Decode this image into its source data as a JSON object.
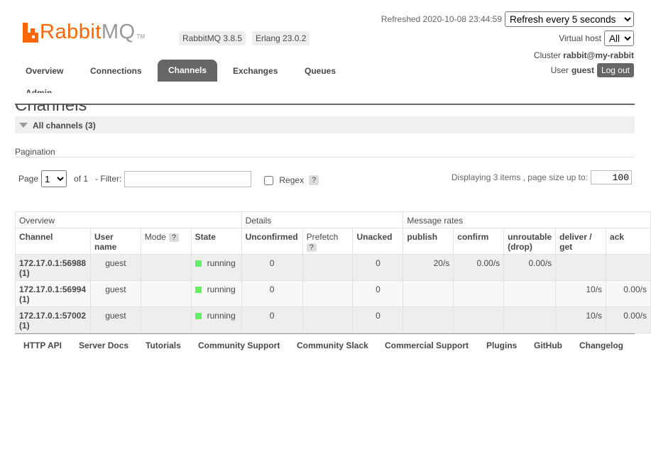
{
  "header": {
    "logo_text_a": "Rabbit",
    "logo_text_b": "MQ",
    "logo_tm": "TM",
    "version": "RabbitMQ 3.8.5",
    "erlang": "Erlang 23.0.2",
    "refreshed_label": "Refreshed 2020-10-08 23:44:59",
    "refresh_option": "Refresh every 5 seconds",
    "vhost_label": "Virtual host",
    "vhost_value": "All",
    "cluster_label": "Cluster",
    "cluster_value": "rabbit@my-rabbit",
    "user_label": "User",
    "user_value": "guest",
    "logout": "Log out"
  },
  "nav": {
    "items": [
      "Overview",
      "Connections",
      "Channels",
      "Exchanges",
      "Queues",
      "Admin"
    ],
    "active": "Channels"
  },
  "page": {
    "title": "Channels",
    "section": "All channels (3)",
    "pagination_label": "Pagination",
    "page_label": "Page",
    "page_value": "1",
    "of_label": "of 1",
    "filter_label": "- Filter:",
    "filter_value": "",
    "regex_label": "Regex",
    "help": "?",
    "displaying": "Displaying 3 items , page size up to:",
    "page_size": "100"
  },
  "table": {
    "groups": [
      "Overview",
      "Details",
      "Message rates"
    ],
    "columns": [
      "Channel",
      "User name",
      "Mode",
      "State",
      "Unconfirmed",
      "Prefetch",
      "Unacked",
      "publish",
      "confirm",
      "unroutable (drop)",
      "deliver / get",
      "ack"
    ],
    "rows": [
      {
        "channel": "172.17.0.1:56988 (1)",
        "user": "guest",
        "mode": "",
        "state": "running",
        "unconfirmed": "0",
        "prefetch": "",
        "unacked": "0",
        "publish": "20/s",
        "confirm": "0.00/s",
        "unroutable": "0.00/s",
        "deliver": "",
        "ack": ""
      },
      {
        "channel": "172.17.0.1:56994 (1)",
        "user": "guest",
        "mode": "",
        "state": "running",
        "unconfirmed": "0",
        "prefetch": "",
        "unacked": "0",
        "publish": "",
        "confirm": "",
        "unroutable": "",
        "deliver": "10/s",
        "ack": "0.00/s"
      },
      {
        "channel": "172.17.0.1:57002 (1)",
        "user": "guest",
        "mode": "",
        "state": "running",
        "unconfirmed": "0",
        "prefetch": "",
        "unacked": "0",
        "publish": "",
        "confirm": "",
        "unroutable": "",
        "deliver": "10/s",
        "ack": "0.00/s"
      }
    ],
    "running_color": "#66ee66"
  },
  "footer": {
    "links": [
      "HTTP API",
      "Server Docs",
      "Tutorials",
      "Community Support",
      "Community Slack",
      "Commercial Support",
      "Plugins",
      "GitHub",
      "Changelog"
    ]
  }
}
